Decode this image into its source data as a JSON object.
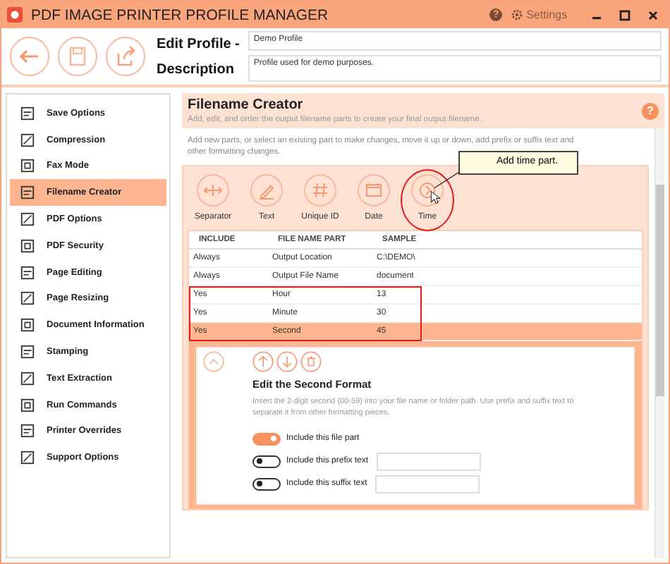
{
  "window": {
    "title": "PDF IMAGE PRINTER PROFILE MANAGER",
    "help": "?",
    "settings": "Settings"
  },
  "profile": {
    "name_label": "Edit Profile -",
    "name_value": "Demo Profile",
    "description_label": "Description",
    "description_value": "Profile used for demo purposes."
  },
  "sidebar": {
    "items": [
      {
        "label": "Save Options",
        "selected": false
      },
      {
        "label": "Compression",
        "selected": false
      },
      {
        "label": "Fax Mode",
        "selected": false
      },
      {
        "label": "Filename Creator",
        "selected": true
      },
      {
        "label": "PDF Options",
        "selected": false
      },
      {
        "label": "PDF Security",
        "selected": false
      },
      {
        "label": "Page Editing",
        "selected": false
      },
      {
        "label": "Page Resizing",
        "selected": false
      },
      {
        "label": "Document Information",
        "selected": false
      },
      {
        "label": "Stamping",
        "selected": false
      },
      {
        "label": "Text Extraction",
        "selected": false
      },
      {
        "label": "Run Commands",
        "selected": false
      },
      {
        "label": "Printer Overrides",
        "selected": false
      },
      {
        "label": "Support Options",
        "selected": false
      }
    ]
  },
  "panel": {
    "title": "Filename Creator",
    "subtitle": "Add, edit, and order the output filename parts to create your final output filename.",
    "help": "?",
    "intro": "Add new parts, or select an existing part to make changes, move it up or down, add prefix or suffix text and other formatting changes.",
    "part_buttons": [
      {
        "label": "Separator",
        "highlighted": false
      },
      {
        "label": "Text",
        "highlighted": false
      },
      {
        "label": "Unique ID",
        "highlighted": false
      },
      {
        "label": "Date",
        "highlighted": false
      },
      {
        "label": "Time",
        "highlighted": true
      }
    ],
    "tooltip": "Add time part.",
    "table": {
      "columns": [
        "INCLUDE",
        "FILE NAME PART",
        "SAMPLE"
      ],
      "rows": [
        {
          "cells": [
            "Always",
            "Output Location",
            "C:\\DEMO\\"
          ],
          "selected": false,
          "highlighted": false
        },
        {
          "cells": [
            "Always",
            "Output File Name",
            "document"
          ],
          "selected": false,
          "highlighted": false
        },
        {
          "cells": [
            "Yes",
            "Hour",
            "13"
          ],
          "selected": false,
          "highlighted": true
        },
        {
          "cells": [
            "Yes",
            "Minute",
            "30"
          ],
          "selected": false,
          "highlighted": true
        },
        {
          "cells": [
            "Yes",
            "Second",
            "45"
          ],
          "selected": true,
          "highlighted": true
        }
      ]
    },
    "editor": {
      "title": "Edit the Second Format",
      "description": "Insert the 2-digit second (00-59) into your file name or folder path. Use prefix and suffix text to separate it from other formatting pieces.",
      "options": [
        {
          "label": "Include this file part",
          "on": true,
          "has_field": false
        },
        {
          "label": "Include this prefix text",
          "on": false,
          "has_field": true
        },
        {
          "label": "Include this suffix text",
          "on": false,
          "has_field": true
        }
      ]
    }
  }
}
